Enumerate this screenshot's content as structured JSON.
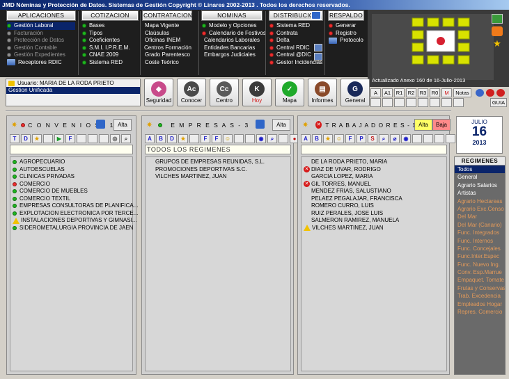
{
  "app": {
    "title": "JMD Nóminas y Protección de Datos. Sistemas de Gestión     Copyright © Linares 2002-2013 .  Todos los derechos reservados."
  },
  "colors": {
    "accent": "#0a246a",
    "ok": "#1fb51f",
    "error": "#ee2d2d",
    "warn": "#f2c200"
  },
  "menus": [
    {
      "label": "APLICACIONES",
      "items": [
        {
          "label": "Gestión Laboral",
          "icon": "green-dot",
          "selected": true
        },
        {
          "label": "Facturación",
          "icon": "grey-dot",
          "dim": true
        },
        {
          "label": "Protección de Datos",
          "icon": "grey-dot",
          "dim": true
        },
        {
          "label": "Gestión Contable",
          "icon": "grey-dot",
          "dim": true
        },
        {
          "label": "Gestión Expedientes",
          "icon": "grey-dot",
          "dim": true
        },
        {
          "label": "Receptores RDIC",
          "icon": "app-icon"
        }
      ]
    },
    {
      "label": "COTIZACION",
      "items": [
        {
          "label": "Bases",
          "icon": "green-dot"
        },
        {
          "label": "Tipos",
          "icon": "green-dot"
        },
        {
          "label": "Coeficientes",
          "icon": "green-dot"
        },
        {
          "label": "S.M.I.  I.P.R.E.M.",
          "icon": "green-dot"
        },
        {
          "label": "CNAE 2009",
          "icon": "green-dot"
        },
        {
          "label": "Sistema RED",
          "icon": "green-dot"
        }
      ]
    },
    {
      "label": "CONTRATACION",
      "items": [
        {
          "label": "Mapa Vigente"
        },
        {
          "label": "Claúsulas"
        },
        {
          "label": "Oficinas INEM"
        },
        {
          "label": "Centros Formación"
        },
        {
          "label": "Grado Parentesco"
        },
        {
          "label": "Coste Teórico"
        }
      ]
    },
    {
      "label": "NOMINAS",
      "items": [
        {
          "label": "Modelo y Opciones",
          "icon": "green-dot"
        },
        {
          "label": "Calendario de Festivos",
          "icon": "red-dot"
        },
        {
          "label": "Calendarios Laborales"
        },
        {
          "label": "Entidades Bancarias"
        },
        {
          "label": "Embargos Judiciales"
        }
      ]
    },
    {
      "label": "DISTRIBUCION",
      "items": [
        {
          "label": "Sistema RED",
          "icon": "red-dot"
        },
        {
          "label": "Contrata",
          "icon": "red-dot"
        },
        {
          "label": "Delta",
          "icon": "red-dot"
        },
        {
          "label": "Central  RDIC",
          "icon": "red-dot"
        },
        {
          "label": "Central  @DIC",
          "icon": "red-dot"
        },
        {
          "label": "Gestor Incidencias",
          "icon": "red-dot"
        }
      ]
    },
    {
      "label": "RESPALDO",
      "items": [
        {
          "label": "Generar",
          "icon": "red-dot"
        },
        {
          "label": "Registro",
          "icon": "red-dot"
        },
        {
          "label": "Protocolo",
          "icon": "app-icon"
        }
      ]
    }
  ],
  "preview": {
    "caption": "Actualizado Anexo 160 de 16-Julio-2013"
  },
  "user": {
    "line1": "Usuario: MARIA DE LA RODA PRIETO",
    "line2": "Gestion Unificada"
  },
  "toolbar": [
    {
      "label": "Seguridad",
      "icon": "shield-icon"
    },
    {
      "label": "Conocer",
      "icon": "ac-icon"
    },
    {
      "label": "Centro",
      "icon": "cc-icon"
    },
    {
      "label": "Hoy",
      "icon": "k-icon"
    },
    {
      "label": "Mapa",
      "icon": "check-icon"
    },
    {
      "label": "Informes",
      "icon": "books-icon"
    },
    {
      "label": "General",
      "icon": "g-icon"
    }
  ],
  "rightbar": {
    "row1": [
      "A",
      "A1",
      "R1",
      "R2",
      "R3",
      "R0",
      "M",
      "Notas"
    ],
    "guia": "GUIA"
  },
  "convenios": {
    "title": "C O N V E N I O S - 1 0",
    "alta": "Alta",
    "tools": [
      "T",
      "D",
      "★",
      "",
      "",
      " F",
      ""
    ],
    "items": [
      {
        "label": "AGROPECUARIO",
        "icon": "green-dot"
      },
      {
        "label": "AUTOESCUELAS",
        "icon": "green-dot"
      },
      {
        "label": "CLINICAS PRIVADAS",
        "icon": "green-dot"
      },
      {
        "label": "COMERCIO",
        "icon": "red-dot"
      },
      {
        "label": "COMERCIO DE MUEBLES",
        "icon": "green-dot"
      },
      {
        "label": "COMERCIO TEXTIL",
        "icon": "green-dot"
      },
      {
        "label": "EMPRESAS CONSULTORAS DE PLANIFICA...",
        "icon": "green-dot"
      },
      {
        "label": "EXPLOTACION ELECTRONICA POR TERCE...",
        "icon": "green-dot"
      },
      {
        "label": "INSTALACIONES DEPORTIVAS Y GIMNASI...",
        "icon": "warn"
      },
      {
        "label": "SIDEROMETALURGIA PROVINCIA DE JAEN",
        "icon": "green-dot"
      }
    ]
  },
  "empresas": {
    "title": "E M P R E S A S - 3",
    "alta": "Alta",
    "filter": "TODOS LOS REGIMENES",
    "items": [
      "GRUPOS DE EMPRESAS REUNIDAS, S.L.",
      "PROMOCIONES DEPORTIVAS S.C.",
      "VILCHES MARTINEZ, JUAN"
    ]
  },
  "trabajadores": {
    "title": "T R A B A J A D O R E S - 1 0",
    "alta": "Alta",
    "baja": "Baja",
    "items": [
      {
        "label": "DE LA RODA PRIETO, MARIA",
        "icon": ""
      },
      {
        "label": "DIAZ DE VIVAR, RODRIGO",
        "icon": "error"
      },
      {
        "label": "GARCIA LOPEZ, MARIA",
        "icon": ""
      },
      {
        "label": "GIL TORRES, MANUEL",
        "icon": "error"
      },
      {
        "label": "MENDEZ FRIAS, SALUSTIANO",
        "icon": ""
      },
      {
        "label": "PELAEZ PEGALAJAR, FRANCISCA",
        "icon": ""
      },
      {
        "label": "ROMERO CURRO, LUIS",
        "icon": ""
      },
      {
        "label": "RUIZ PERALES, JOSE LUIS",
        "icon": ""
      },
      {
        "label": "SALMERON RAMIREZ, MANUELA",
        "icon": ""
      },
      {
        "label": "VILCHES MARTINEZ, JUAN",
        "icon": "warn"
      }
    ]
  },
  "calendar": {
    "month": "JULIO",
    "day": "16",
    "year": "2013"
  },
  "regimenes": {
    "title": "REGIMENES",
    "items": [
      {
        "label": "Todos",
        "state": "selected"
      },
      {
        "label": "General",
        "state": "active"
      },
      {
        "label": "Agrario Salarios",
        "state": "active"
      },
      {
        "label": "Artistas",
        "state": "active"
      },
      {
        "label": "Agrario Hectareas",
        "state": "inactive"
      },
      {
        "label": "Agrario Exc.Censo",
        "state": "inactive"
      },
      {
        "label": "Del Mar",
        "state": "inactive"
      },
      {
        "label": "Del Mar (Canario)",
        "state": "inactive"
      },
      {
        "label": "Func. Integrados",
        "state": "inactive"
      },
      {
        "label": "Func. Internos",
        "state": "inactive"
      },
      {
        "label": "Func. Concejales",
        "state": "inactive"
      },
      {
        "label": "Func.Inter.Espec",
        "state": "inactive"
      },
      {
        "label": "Func. Nuevo Ing.",
        "state": "inactive"
      },
      {
        "label": "Conv. Esp.Marrue",
        "state": "inactive"
      },
      {
        "label": "Empaquet. Tomate",
        "state": "inactive"
      },
      {
        "label": "Frutas y Conservas",
        "state": "inactive"
      },
      {
        "label": "Trab. Excedencia",
        "state": "inactive"
      },
      {
        "label": "Empleados Hogar",
        "state": "inactive"
      },
      {
        "label": "Repres. Comercio",
        "state": "inactive"
      }
    ]
  }
}
